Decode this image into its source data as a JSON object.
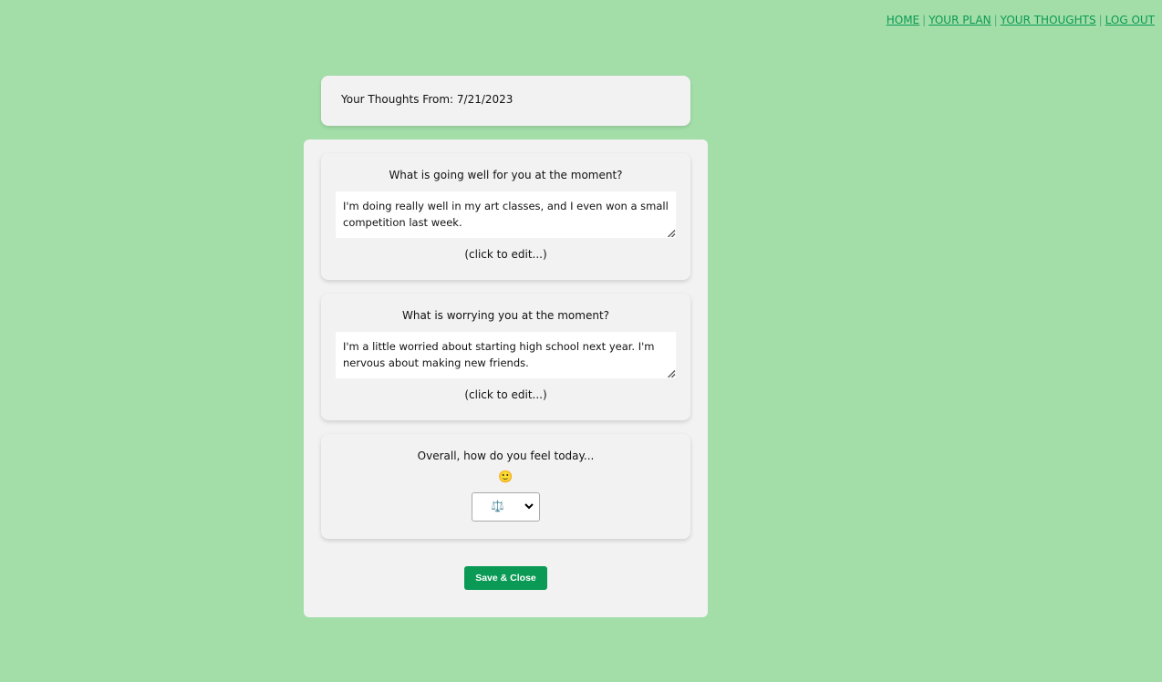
{
  "nav": {
    "items": [
      {
        "label": "HOME"
      },
      {
        "label": "YOUR PLAN"
      },
      {
        "label": "YOUR THOUGHTS"
      },
      {
        "label": "LOG OUT"
      }
    ],
    "separator": "|"
  },
  "header": {
    "title": "Your Thoughts From: 7/21/2023"
  },
  "questions": [
    {
      "prompt": "What is going well for you at the moment?",
      "answer": "I'm doing really well in my art classes, and I even won a small competition last week.",
      "edit_hint": "(click to edit...)"
    },
    {
      "prompt": "What is worrying you at the moment?",
      "answer": "I'm a little worried about starting high school next year. I'm nervous about making new friends.",
      "edit_hint": "(click to edit...)"
    }
  ],
  "mood": {
    "prompt": "Overall, how do you feel today...",
    "emoji": "🙂",
    "selected": "⚖️"
  },
  "actions": {
    "save_label": "Save & Close"
  },
  "colors": {
    "background": "#a3dea8",
    "accent": "#0a9a55",
    "card": "#f2f2f2"
  }
}
